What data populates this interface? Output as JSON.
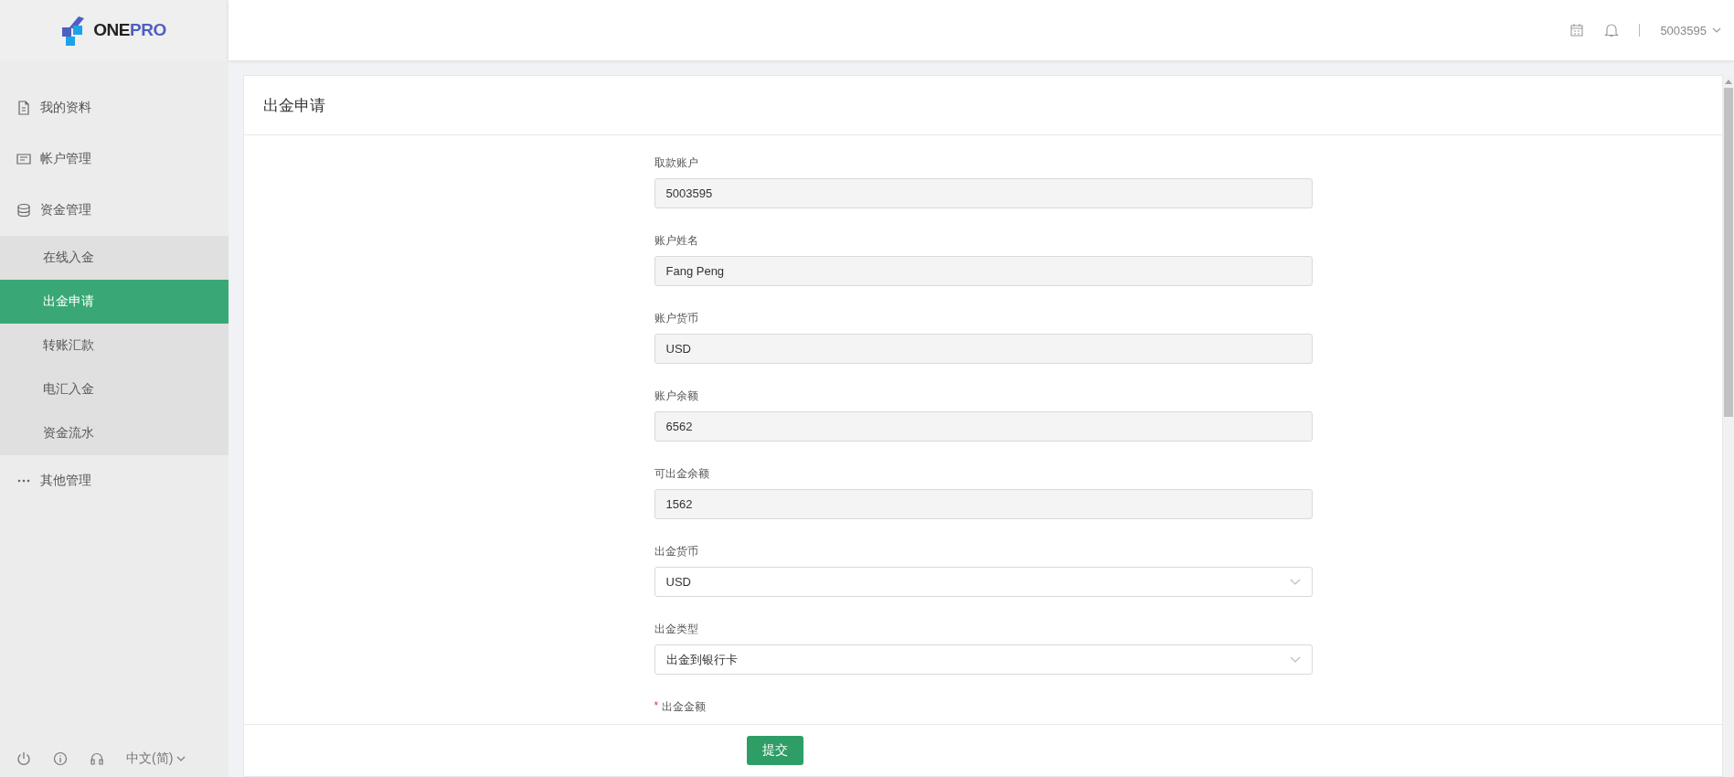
{
  "header": {
    "logo": {
      "text_1": "ONE",
      "text_2": "PRO"
    },
    "user": "5003595"
  },
  "sidebar": {
    "items": [
      {
        "label": "我的资料",
        "selected": false
      },
      {
        "label": "帐户管理",
        "selected": false
      },
      {
        "label": "资金管理",
        "selected": false,
        "children": [
          {
            "label": "在线入金",
            "selected": false
          },
          {
            "label": "出金申请",
            "selected": true
          },
          {
            "label": "转账汇款",
            "selected": false
          },
          {
            "label": "电汇入金",
            "selected": false
          },
          {
            "label": "资金流水",
            "selected": false
          }
        ]
      },
      {
        "label": "其他管理",
        "selected": false
      }
    ],
    "language": "中文(简)"
  },
  "page": {
    "title": "出金申请",
    "fields": [
      {
        "label": "取款账户",
        "value": "5003595",
        "kind": "readonly",
        "required": false
      },
      {
        "label": "账户姓名",
        "value": "Fang Peng",
        "kind": "readonly",
        "required": false
      },
      {
        "label": "账户货币",
        "value": "USD",
        "kind": "readonly",
        "required": false
      },
      {
        "label": "账户余额",
        "value": "6562",
        "kind": "readonly",
        "required": false
      },
      {
        "label": "可出金余额",
        "value": "1562",
        "kind": "readonly",
        "required": false
      },
      {
        "label": "出金货币",
        "value": "USD",
        "kind": "select",
        "required": false
      },
      {
        "label": "出金类型",
        "value": "出金到银行卡",
        "kind": "select",
        "required": false
      },
      {
        "label": "出金金额",
        "kind": "label",
        "required": true
      }
    ],
    "required_mark": "*",
    "submit": "提交"
  }
}
